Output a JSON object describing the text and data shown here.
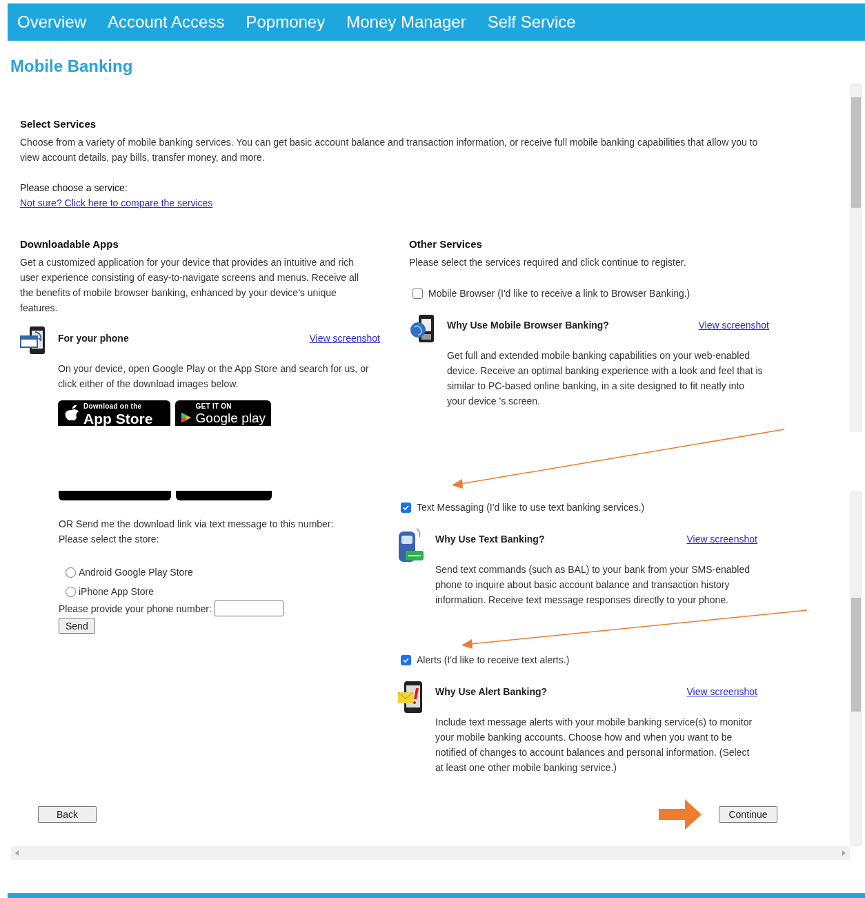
{
  "nav": [
    {
      "label": "Overview"
    },
    {
      "label": "Account Access"
    },
    {
      "label": "Popmoney"
    },
    {
      "label": "Money Manager"
    },
    {
      "label": "Self Service"
    }
  ],
  "page_title": "Mobile Banking",
  "select_services": {
    "heading": "Select Services",
    "intro": "Choose from a variety of mobile banking services. You can get basic account balance and transaction information, or receive full mobile banking capabilities that allow you to view account details, pay bills, transfer money, and more.",
    "prompt": "Please choose a service:",
    "compare_link": "Not sure? Click here to compare the services"
  },
  "downloadable_apps": {
    "heading": "Downloadable Apps",
    "description": "Get a customized application for your device that provides an intuitive and rich user experience consisting of easy-to-navigate screens and menus. Receive all the benefits of mobile browser banking, enhanced by your device's unique features.",
    "phone_title": "For your phone",
    "phone_link": "View screenshot",
    "instructions": "On your device, open Google Play or the App Store and search for us, or click either of the download images below.",
    "badges": [
      {
        "kind": "apple",
        "line1": "Download on the",
        "line2": "App Store"
      },
      {
        "kind": "google",
        "line1": "GET IT ON",
        "line2": "Google play"
      }
    ],
    "sms_prompt": "OR Send me the download link via text message to this number:",
    "store_prompt": "Please select the store:",
    "stores": [
      {
        "label": "Android Google Play Store",
        "selected": false
      },
      {
        "label": "iPhone App Store",
        "selected": false
      }
    ],
    "phone_label": "Please provide your phone number:",
    "send": "Send"
  },
  "other_services": {
    "heading": "Other Services",
    "description": "Please select the services required and click continue to register.",
    "services": [
      {
        "kind": "browser",
        "label": "Mobile Browser (I'd like to receive a link to Browser Banking.)",
        "checked": false,
        "title": "Why Use Mobile Browser Banking?",
        "link": "View screenshot",
        "description": "Get full and extended mobile banking capabilities on your web-enabled device. Receive an optimal banking experience with a look and feel that is similar to PC-based online banking, in a site designed to fit neatly into your device 's screen."
      },
      {
        "kind": "text",
        "label": "Text Messaging (I'd like to use text banking services.)",
        "checked": true,
        "title": "Why Use Text Banking?",
        "link": "View screenshot",
        "description": "Send text commands (such as BAL) to your bank from your SMS-enabled phone to inquire about basic account balance and transaction history information. Receive text message responses directly to your phone."
      },
      {
        "kind": "alert",
        "label": "Alerts (I'd like to receive text alerts.)",
        "checked": true,
        "title": "Why Use Alert Banking?",
        "link": "View screenshot",
        "description": "Include text message alerts with your mobile banking service(s) to monitor your mobile banking accounts. Choose how and when you want to be notified of changes to account balances and personal information. (Select at least one other mobile banking service.)"
      }
    ]
  },
  "buttons": {
    "back": "Back",
    "continue": "Continue"
  }
}
